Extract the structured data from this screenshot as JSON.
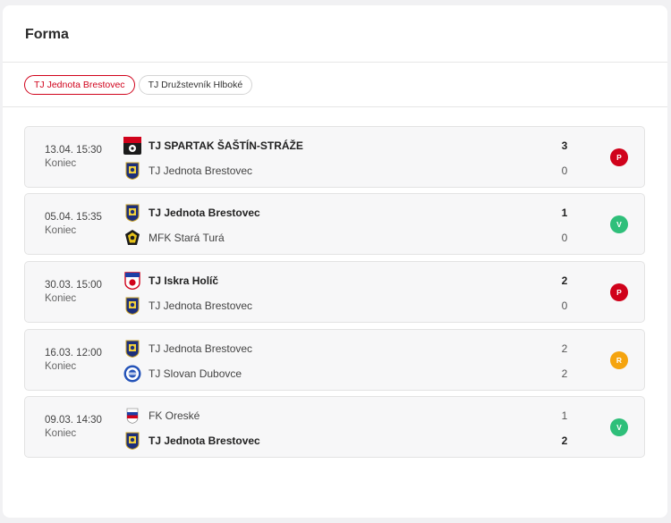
{
  "header": {
    "title": "Forma"
  },
  "tabs": [
    {
      "label": "TJ Jednota Brestovec",
      "active": true
    },
    {
      "label": "TJ Družstevník Hlboké",
      "active": false
    }
  ],
  "colors": {
    "loss": "#d0021b",
    "win": "#2fbf7a",
    "draw": "#f5a40f"
  },
  "matches": [
    {
      "date": "13.04. 15:30",
      "status": "Koniec",
      "home": {
        "name": "TJ SPARTAK ŠAŠTÍN-STRÁŽE",
        "score": "3",
        "winner": true,
        "logo": "spartak-logo"
      },
      "away": {
        "name": "TJ Jednota Brestovec",
        "score": "0",
        "winner": false,
        "logo": "brestovec-logo"
      },
      "result": "P",
      "result_type": "loss"
    },
    {
      "date": "05.04. 15:35",
      "status": "Koniec",
      "home": {
        "name": "TJ Jednota Brestovec",
        "score": "1",
        "winner": true,
        "logo": "brestovec-logo"
      },
      "away": {
        "name": "MFK Stará Turá",
        "score": "0",
        "winner": false,
        "logo": "stara-tura-logo"
      },
      "result": "V",
      "result_type": "win"
    },
    {
      "date": "30.03. 15:00",
      "status": "Koniec",
      "home": {
        "name": "TJ Iskra Holíč",
        "score": "2",
        "winner": true,
        "logo": "iskra-logo"
      },
      "away": {
        "name": "TJ Jednota Brestovec",
        "score": "0",
        "winner": false,
        "logo": "brestovec-logo"
      },
      "result": "P",
      "result_type": "loss"
    },
    {
      "date": "16.03. 12:00",
      "status": "Koniec",
      "home": {
        "name": "TJ Jednota Brestovec",
        "score": "2",
        "winner": false,
        "logo": "brestovec-logo"
      },
      "away": {
        "name": "TJ Slovan Dubovce",
        "score": "2",
        "winner": false,
        "logo": "dubovce-logo"
      },
      "result": "R",
      "result_type": "draw"
    },
    {
      "date": "09.03. 14:30",
      "status": "Koniec",
      "home": {
        "name": "FK Oreské",
        "score": "1",
        "winner": false,
        "logo": "oreske-logo"
      },
      "away": {
        "name": "TJ Jednota Brestovec",
        "score": "2",
        "winner": true,
        "logo": "brestovec-logo"
      },
      "result": "V",
      "result_type": "win"
    }
  ]
}
